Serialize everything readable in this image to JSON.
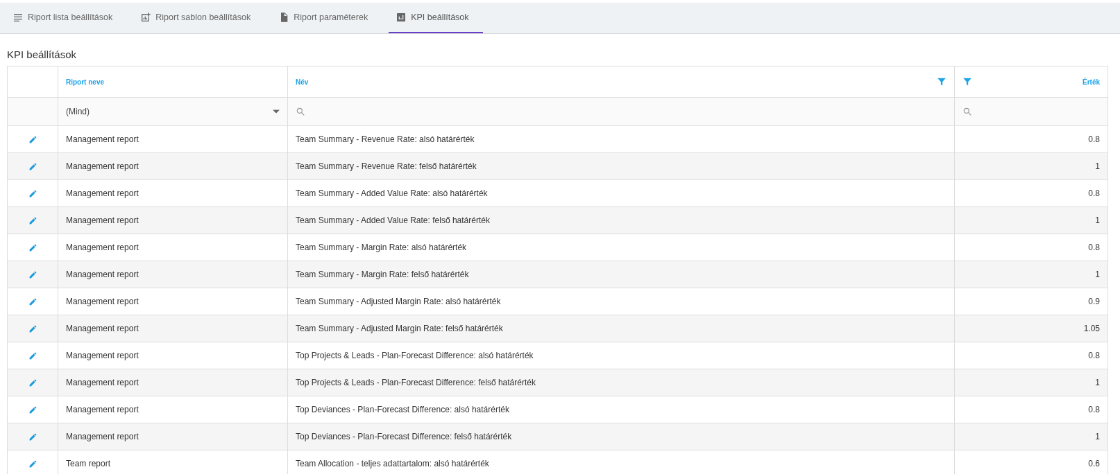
{
  "tabs": [
    {
      "label": "Riport lista beállítások",
      "selected": false
    },
    {
      "label": "Riport sablon beállítások",
      "selected": false
    },
    {
      "label": "Riport paraméterek",
      "selected": false
    },
    {
      "label": "KPI beállítások",
      "selected": true
    }
  ],
  "title": "KPI beállítások",
  "table": {
    "columns": [
      {
        "label": "Riport neve",
        "filter_icon": false
      },
      {
        "label": "Név",
        "filter_icon": true
      },
      {
        "label": "Érték",
        "filter_icon": true
      }
    ],
    "filter_row": {
      "report_select": "(Mind)"
    },
    "rows": [
      {
        "report": "Management report",
        "name": "Team Summary - Revenue Rate: alsó határérték",
        "value": "0.8"
      },
      {
        "report": "Management report",
        "name": "Team Summary - Revenue Rate: felső határérték",
        "value": "1"
      },
      {
        "report": "Management report",
        "name": "Team Summary - Added Value Rate: alsó határérték",
        "value": "0.8"
      },
      {
        "report": "Management report",
        "name": "Team Summary - Added Value Rate: felső határérték",
        "value": "1"
      },
      {
        "report": "Management report",
        "name": "Team Summary - Margin Rate: alsó határérték",
        "value": "0.8"
      },
      {
        "report": "Management report",
        "name": "Team Summary - Margin Rate: felső határérték",
        "value": "1"
      },
      {
        "report": "Management report",
        "name": "Team Summary - Adjusted Margin Rate: alsó határérték",
        "value": "0.9"
      },
      {
        "report": "Management report",
        "name": "Team Summary - Adjusted Margin Rate: felső határérték",
        "value": "1.05"
      },
      {
        "report": "Management report",
        "name": "Top Projects & Leads - Plan-Forecast Difference: alsó határérték",
        "value": "0.8"
      },
      {
        "report": "Management report",
        "name": "Top Projects & Leads - Plan-Forecast Difference: felső határérték",
        "value": "1"
      },
      {
        "report": "Management report",
        "name": "Top Deviances - Plan-Forecast Difference: alsó határérték",
        "value": "0.8"
      },
      {
        "report": "Management report",
        "name": "Top Deviances - Plan-Forecast Difference: felső határérték",
        "value": "1"
      },
      {
        "report": "Team report",
        "name": "Team Allocation - teljes adattartalom: alsó határérték",
        "value": "0.6"
      }
    ]
  }
}
